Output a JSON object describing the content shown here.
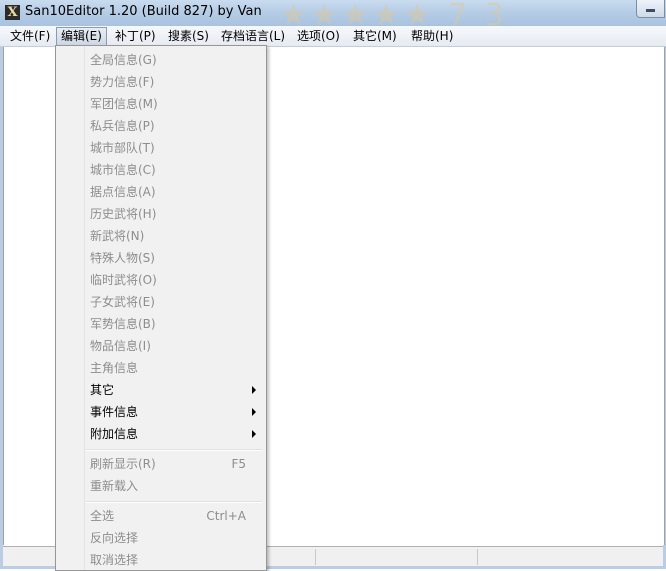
{
  "window": {
    "title": "San10Editor 1.20 (Build 827) by Van",
    "icon_char": "X",
    "title_decoration": "★★★★★ 7 3"
  },
  "menubar": {
    "items": [
      {
        "label": "文件(F)"
      },
      {
        "label": "编辑(E)",
        "active": true
      },
      {
        "label": "补丁(P)"
      },
      {
        "label": "搜素(S)"
      },
      {
        "label": "存档语言(L)"
      },
      {
        "label": "选项(O)"
      },
      {
        "label": "其它(M)"
      },
      {
        "label": "帮助(H)"
      }
    ]
  },
  "edit_menu": {
    "items": [
      {
        "label": "全局信息(G)",
        "enabled": false
      },
      {
        "label": "势力信息(F)",
        "enabled": false
      },
      {
        "label": "军团信息(M)",
        "enabled": false
      },
      {
        "label": "私兵信息(P)",
        "enabled": false
      },
      {
        "label": "城市部队(T)",
        "enabled": false
      },
      {
        "label": "城市信息(C)",
        "enabled": false
      },
      {
        "label": "据点信息(A)",
        "enabled": false
      },
      {
        "label": "历史武将(H)",
        "enabled": false
      },
      {
        "label": "新武将(N)",
        "enabled": false
      },
      {
        "label": "特殊人物(S)",
        "enabled": false
      },
      {
        "label": "临时武将(O)",
        "enabled": false
      },
      {
        "label": "子女武将(E)",
        "enabled": false
      },
      {
        "label": "军势信息(B)",
        "enabled": false
      },
      {
        "label": "物品信息(I)",
        "enabled": false
      },
      {
        "label": "主角信息",
        "enabled": false
      },
      {
        "label": "其它",
        "enabled": true,
        "submenu": true
      },
      {
        "label": "事件信息",
        "enabled": true,
        "submenu": true
      },
      {
        "label": "附加信息",
        "enabled": true,
        "submenu": true
      },
      {
        "label": "刷新显示(R)",
        "enabled": false,
        "shortcut": "F5"
      },
      {
        "label": "重新载入",
        "enabled": false
      },
      {
        "label": "全选",
        "enabled": false,
        "shortcut": "Ctrl+A"
      },
      {
        "label": "反向选择",
        "enabled": false
      },
      {
        "label": "取消选择",
        "enabled": false
      }
    ]
  },
  "colors": {
    "disabled_text": "#8d8d8d",
    "menu_background": "#f1f1f1",
    "titlebar": "#b7cde6"
  }
}
